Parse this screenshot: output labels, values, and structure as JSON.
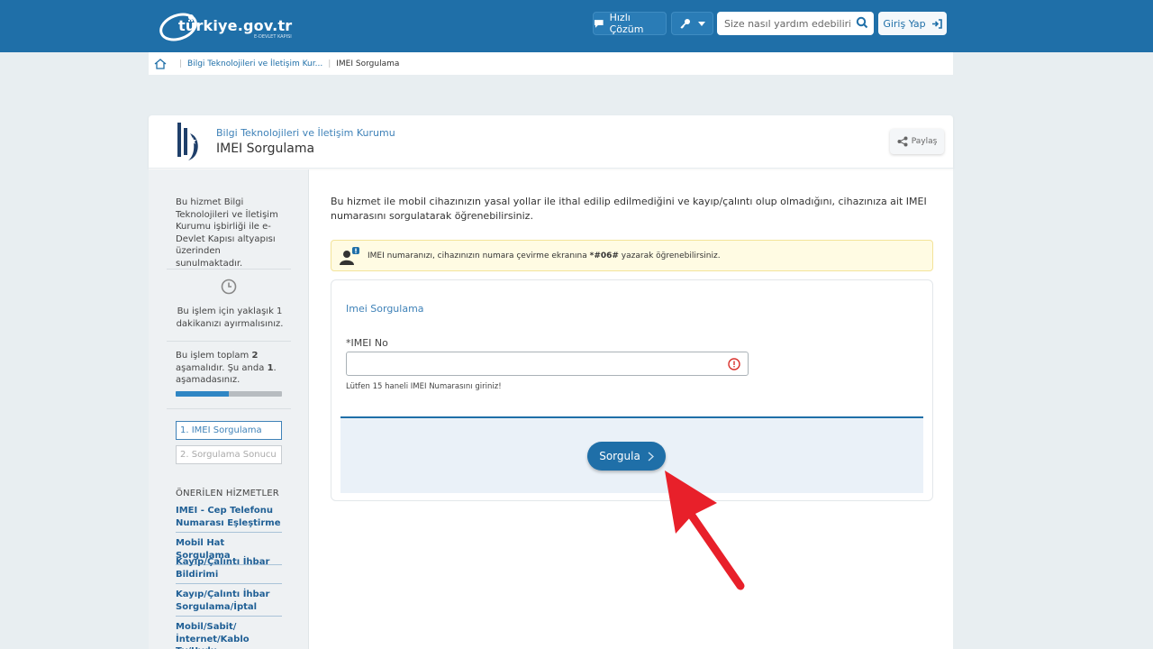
{
  "header": {
    "logo_text": "türkiye.gov.tr",
    "logo_sub": "E-DEVLET KAPISI",
    "quick_solution": "Hızlı Çözüm",
    "search_placeholder": "Size nasıl yardım edebilirim?",
    "login": "Giriş Yap"
  },
  "breadcrumb": {
    "items": [
      "Bilgi Teknolojileri ve İletişim Kur...",
      "IMEI Sorgulama"
    ]
  },
  "service": {
    "institution": "Bilgi Teknolojileri ve İletişim Kurumu",
    "title": "IMEI Sorgulama",
    "share": "Paylaş"
  },
  "sidebar": {
    "info": "Bu hizmet Bilgi Teknolojileri ve İletişim Kurumu işbirliği ile e-Devlet Kapısı altyapısı üzerinden sunulmaktadır.",
    "time": "Bu işlem için yaklaşık 1 dakikanızı ayırmalısınız.",
    "steps_prefix": "Bu işlem toplam ",
    "steps_total": "2",
    "steps_mid": " aşamalıdır. Şu anda ",
    "steps_current": "1",
    "steps_suffix": ". aşamadasınız.",
    "progress": 0.5,
    "step1": "1. IMEI Sorgulama",
    "step2": "2. Sorgulama Sonucu",
    "recommended_title": "ÖNERİLEN HİZMETLER",
    "recommended": [
      "IMEI - Cep Telefonu Numarası Eşleştirme",
      "Mobil Hat Sorgulama",
      "Kayıp/Çalıntı İhbar Bildirimi",
      "Kayıp/Çalıntı İhbar Sorgulama/İptal",
      "Mobil/Sabit/ İnternet/Kablo Tv/Uydu"
    ]
  },
  "main": {
    "description": "Bu hizmet ile mobil cihazınızın yasal yollar ile ithal edilip edilmediğini ve kayıp/çalıntı olup olmadığını, cihazınıza ait IMEI numarasını sorgulatarak öğrenebilirsiniz.",
    "alert_pre": "IMEI numaranızı, cihazınızın numara çevirme ekranına ",
    "alert_code": "*#06#",
    "alert_post": " yazarak öğrenebilirsiniz.",
    "form_title": "Imei Sorgulama",
    "field_label": "*IMEI No",
    "field_value": "",
    "field_hint": "Lütfen 15 haneli IMEI Numarasını giriniz!",
    "submit": "Sorgula"
  },
  "colors": {
    "primary": "#1f6fa8",
    "annotation_arrow": "#e8202a"
  }
}
